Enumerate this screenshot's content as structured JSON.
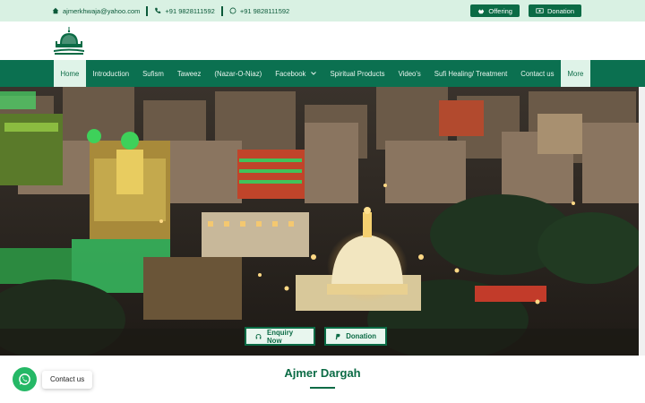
{
  "topbar": {
    "email": "ajmerkhwaja@yahoo.com",
    "phone": "+91 9828111592",
    "whatsapp": "+91 9828111592",
    "offering_label": "Offering",
    "donation_label": "Donation"
  },
  "nav": {
    "items": [
      {
        "label": "Home"
      },
      {
        "label": "Introduction"
      },
      {
        "label": "Sufism"
      },
      {
        "label": "Taweez"
      },
      {
        "label": "(Nazar-O-Niaz)"
      },
      {
        "label": "Facebook"
      },
      {
        "label": "Spiritual Products"
      },
      {
        "label": "Video's"
      },
      {
        "label": "Sufi Healing/ Treatment"
      },
      {
        "label": "Contact us"
      },
      {
        "label": "More"
      }
    ]
  },
  "hero": {
    "enquiry_label": "Enquiry Now",
    "donation_label": "Donation"
  },
  "section": {
    "title": "Ajmer Dargah"
  },
  "chat": {
    "label": "Contact us"
  },
  "colors": {
    "brand": "#0b6b45",
    "topbar_bg": "#d9f1e3",
    "whatsapp": "#25b866"
  }
}
